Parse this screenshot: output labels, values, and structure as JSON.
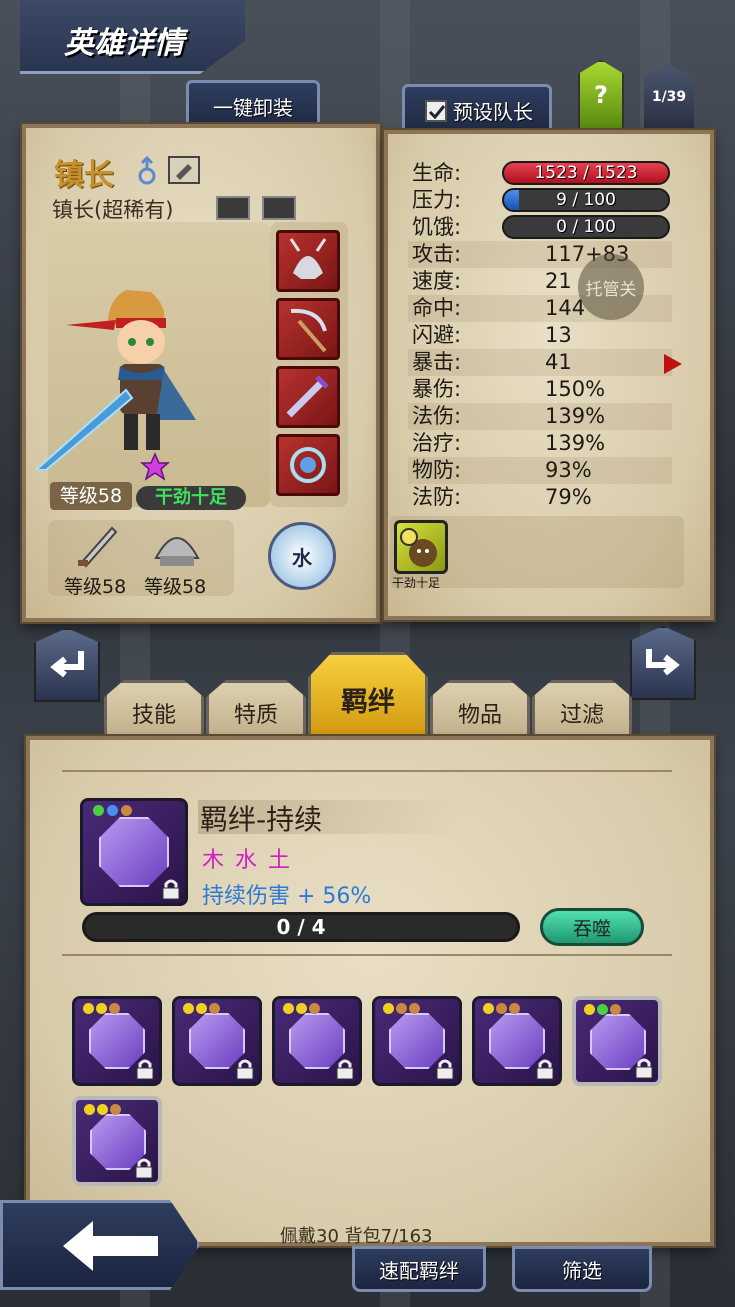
{
  "header": {
    "title": "英雄详情"
  },
  "top_buttons": {
    "unequip_all": "一键卸装",
    "preset_captain": "预设队长",
    "help": "?",
    "hero_index": "1/39"
  },
  "hero": {
    "name": "镇长",
    "class_line": "镇长(超稀有)",
    "level_label": "等级58",
    "trait": "干劲十足",
    "element": "水",
    "weapon_level": "等级58",
    "armor_level": "等级58",
    "trait_icon_label": "干劲十足"
  },
  "stats": {
    "hp_label": "生命:",
    "hp_value": "1523 / 1523",
    "hp_fraction": 1.0,
    "stress_label": "压力:",
    "stress_value": "9 / 100",
    "stress_fraction": 0.09,
    "hunger_label": "饥饿:",
    "hunger_value": "0 / 100",
    "hunger_fraction": 0.0,
    "rows": [
      {
        "label": "攻击:",
        "value": "117+83"
      },
      {
        "label": "速度:",
        "value": "21"
      },
      {
        "label": "命中:",
        "value": "144"
      },
      {
        "label": "闪避:",
        "value": "13"
      },
      {
        "label": "暴击:",
        "value": "41"
      },
      {
        "label": "暴伤:",
        "value": "150%"
      },
      {
        "label": "法伤:",
        "value": "139%"
      },
      {
        "label": "治疗:",
        "value": "139%"
      },
      {
        "label": "物防:",
        "value": "93%"
      },
      {
        "label": "法防:",
        "value": "79%"
      }
    ],
    "auto_toggle": "托管关"
  },
  "tabs": [
    "技能",
    "特质",
    "羁绊",
    "物品",
    "过滤"
  ],
  "active_tab_index": 2,
  "bond": {
    "title": "羁绊-持续",
    "elements": "木 水 土",
    "effect": "持续伤害 + 56%",
    "progress": "0 / 4",
    "progress_fraction": 0.0,
    "devour_label": "吞噬"
  },
  "inventory_status": "佩戴30 背包7/163",
  "bottom_buttons": {
    "quick_bond": "速配羁绊",
    "filter": "筛选"
  },
  "colors": {
    "hp": "#d02030",
    "stress": "#2a6fd0",
    "accent": "#e8b820",
    "bond_title": "#2a2218",
    "elements": "#d020c0",
    "effect": "#2a7ad8"
  }
}
